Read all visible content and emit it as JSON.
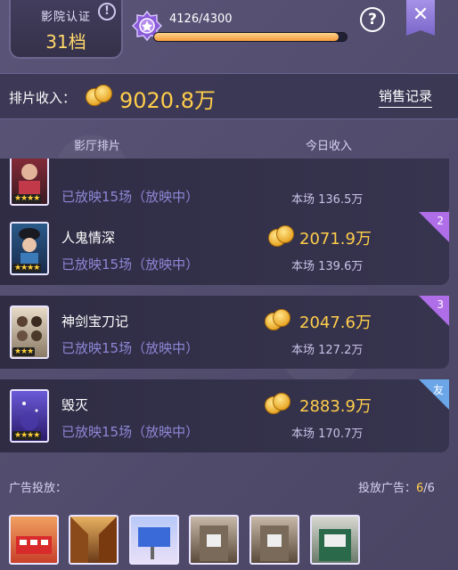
{
  "cinema_badge": {
    "title": "影院认证",
    "level": "31档",
    "info_glyph": "!"
  },
  "progress": {
    "text": "4126/4300",
    "current": 4126,
    "max": 4300,
    "fraction": 0.96
  },
  "top_buttons": {
    "help_glyph": "?",
    "close_glyph": "✕"
  },
  "revenue": {
    "label": "排片收入：",
    "value": "9020.8万",
    "sales_link": "销售记录"
  },
  "columns": {
    "schedule": "影厅排片",
    "today_income": "今日收入"
  },
  "movies": [
    {
      "name": "",
      "status": "已放映15场（放映中）",
      "income": "",
      "session": "本场 136.5万",
      "stars": "★★★★",
      "rank": ""
    },
    {
      "name": "人鬼情深",
      "status": "已放映15场（放映中）",
      "income": "2071.9万",
      "session": "本场 139.6万",
      "stars": "★★★★",
      "rank": "2"
    },
    {
      "name": "神剑宝刀记",
      "status": "已放映15场（放映中）",
      "income": "2047.6万",
      "session": "本场 127.2万",
      "stars": "★★★",
      "rank": "3"
    },
    {
      "name": "毁灭",
      "status": "已放映15场（放映中）",
      "income": "2883.9万",
      "session": "本场 170.7万",
      "stars": "★★★★",
      "rank": "友"
    }
  ],
  "ads": {
    "label": "广告投放：",
    "count_label": "投放广告：",
    "count_current": "6",
    "count_total": "/6"
  },
  "colors": {
    "gold": "#ffce4a",
    "status_purple": "#8e86d6",
    "rank_purple": "#b06de8",
    "friend_blue": "#6aa6e8"
  }
}
